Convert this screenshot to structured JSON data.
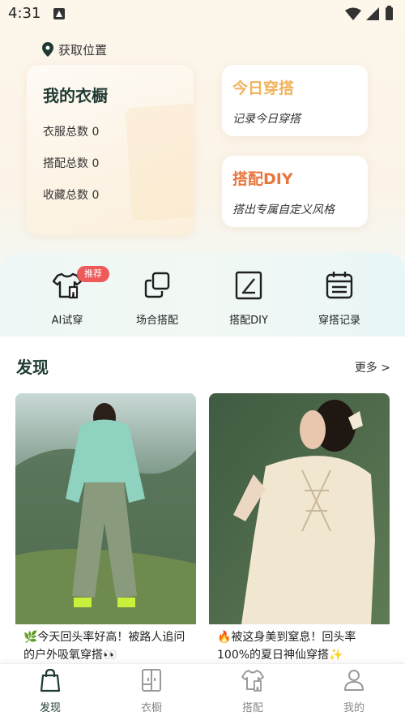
{
  "status_bar": {
    "time": "4:31"
  },
  "location": {
    "label": "获取位置"
  },
  "wardrobe": {
    "title": "我的衣橱",
    "stats": [
      "衣服总数 0",
      "搭配总数 0",
      "收藏总数 0"
    ]
  },
  "quick_cards": [
    {
      "title": "今日穿搭",
      "subtitle": "记录今日穿搭",
      "color": "#f0b35c"
    },
    {
      "title": "搭配DIY",
      "subtitle": "搭出专属自定义风格",
      "color": "#e8763c"
    }
  ],
  "features": [
    {
      "label": "AI试穿",
      "icon": "tshirt-icon",
      "badge": "推荐"
    },
    {
      "label": "场合搭配",
      "icon": "copy-squares-icon"
    },
    {
      "label": "搭配DIY",
      "icon": "edit-pen-icon"
    },
    {
      "label": "穿搭记录",
      "icon": "calendar-list-icon"
    }
  ],
  "discover": {
    "title": "发现",
    "more": "更多 >",
    "posts": [
      {
        "caption": "🌿今天回头率好高！被路人追问的户外吸氧穿搭👀",
        "image": "outdoor-outfit-photo"
      },
      {
        "caption": "🔥被这身美到窒息！回头率100%的夏日神仙穿搭✨",
        "image": "summer-dress-photo"
      }
    ]
  },
  "bottom_nav": [
    {
      "label": "发现",
      "icon": "shopping-bag-icon",
      "active": true
    },
    {
      "label": "衣橱",
      "icon": "wardrobe-icon",
      "active": false
    },
    {
      "label": "搭配",
      "icon": "outfit-icon",
      "active": false
    },
    {
      "label": "我的",
      "icon": "user-icon",
      "active": false
    }
  ],
  "colors": {
    "accent_dark": "#1f3a33",
    "badge_red": "#ee5a5a",
    "nav_active": "#1f3a33",
    "nav_inactive": "#8a8a8a"
  }
}
